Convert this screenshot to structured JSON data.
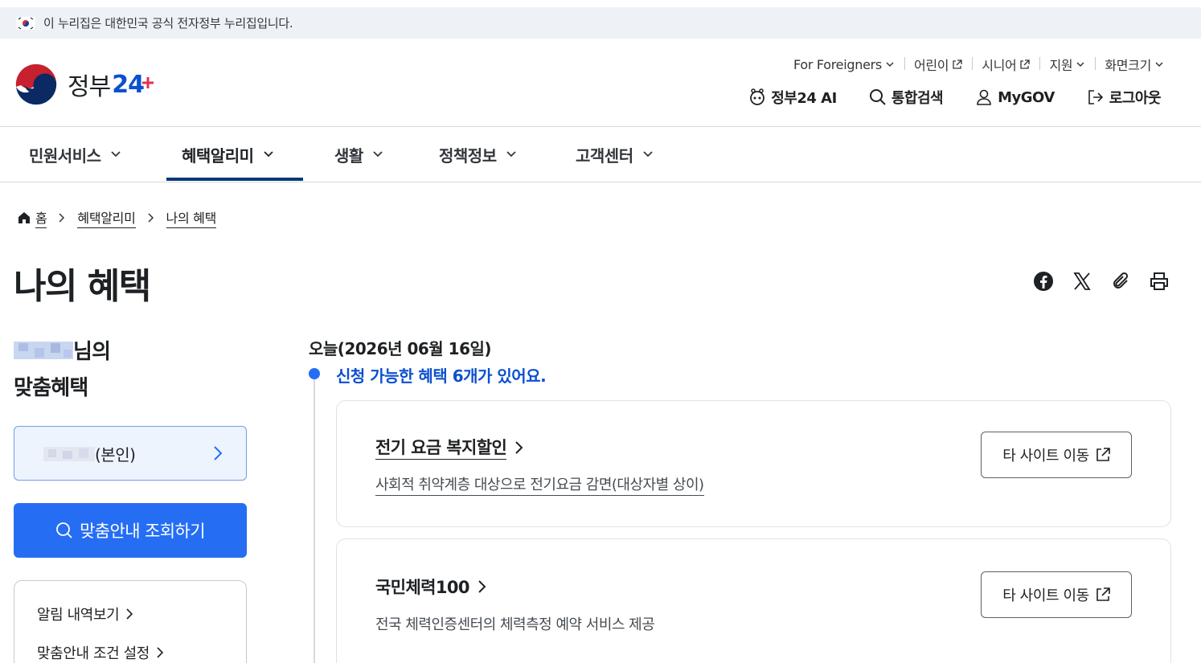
{
  "gov_banner": {
    "text": "이 누리집은 대한민국 공식 전자정부 누리집입니다."
  },
  "logo": {
    "wordmark_text": "정부",
    "wordmark_num": "24"
  },
  "util_links": [
    {
      "label": "For Foreigners",
      "icon": "chevron-down-icon"
    },
    {
      "label": "어린이",
      "icon": "external-link-icon"
    },
    {
      "label": "시니어",
      "icon": "external-link-icon"
    },
    {
      "label": "지원",
      "icon": "chevron-down-icon"
    },
    {
      "label": "화면크기",
      "icon": "chevron-down-icon"
    }
  ],
  "quick_links": [
    {
      "label": "정부24 AI",
      "icon": "ai-robot-icon"
    },
    {
      "label": "통합검색",
      "icon": "search-icon"
    },
    {
      "label": "MyGOV",
      "icon": "user-icon"
    },
    {
      "label": "로그아웃",
      "icon": "logout-icon"
    }
  ],
  "gnb": [
    {
      "label": "민원서비스"
    },
    {
      "label": "혜택알리미",
      "active": true
    },
    {
      "label": "생활"
    },
    {
      "label": "정책정보"
    },
    {
      "label": "고객센터"
    }
  ],
  "breadcrumb": [
    "홈",
    "혜택알리미",
    "나의 혜택"
  ],
  "page_title": "나의 혜택",
  "share_icons": [
    "facebook-icon",
    "x-icon",
    "clip-icon",
    "print-icon"
  ],
  "left": {
    "greet_suffix": "님의",
    "greet_line2": "맞춤혜택",
    "person_label": "(본인)",
    "search_button": "맞춤안내 조회하기",
    "links": [
      "알림 내역보기",
      "맞춤안내 조건 설정"
    ]
  },
  "timeline": {
    "today": "오늘(2026년 06월 16일)",
    "count_message": "신청 가능한 혜택 6개가 있어요."
  },
  "benefits": [
    {
      "title": "전기 요금 복지할인",
      "desc": "사회적 취약계층 대상으로 전기요금 감면(대상자별 상이)",
      "button": "타 사이트 이동"
    },
    {
      "title": "국민체력100",
      "desc": "전국 체력인증센터의 체력측정 예약 서비스 제공",
      "button": "타 사이트 이동"
    }
  ],
  "colors": {
    "primary": "#256ef4",
    "navy": "#063a74",
    "accent_text": "#0b50d0"
  }
}
